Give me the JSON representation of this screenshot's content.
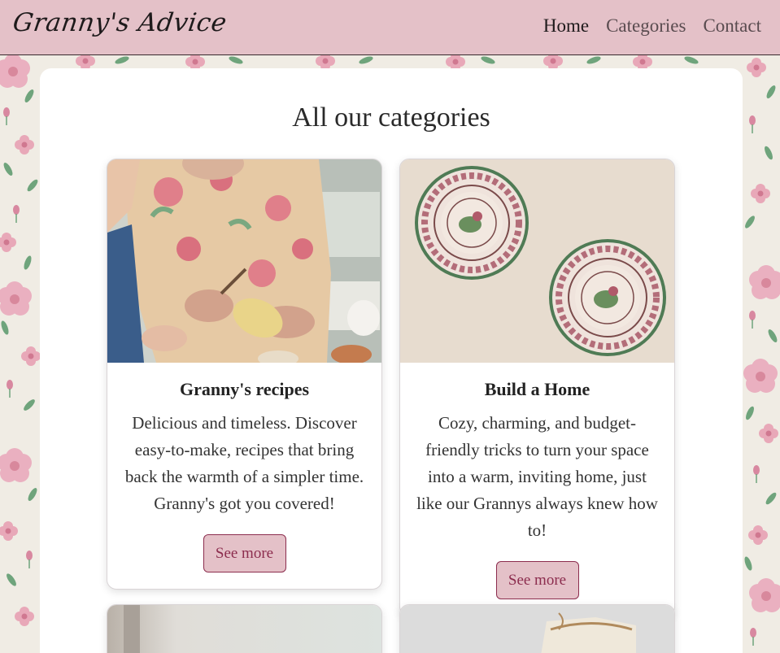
{
  "header": {
    "logo": "Granny's Advice",
    "nav": [
      {
        "label": "Home",
        "active": true
      },
      {
        "label": "Categories",
        "active": false
      },
      {
        "label": "Contact",
        "active": false
      }
    ]
  },
  "main": {
    "title": "All our categories",
    "cards": [
      {
        "title": "Granny's recipes",
        "description": "Delicious and timeless. Discover easy-to-make, recipes that bring back the warmth of a simpler time. Granny's got you covered!",
        "button": "See more"
      },
      {
        "title": "Build a Home",
        "description": "Cozy, charming, and budget-friendly tricks to turn your space into a warm, inviting home, just like our Grannys always knew how to!",
        "button": "See more"
      }
    ]
  },
  "colors": {
    "header_bg": "#e4c1c8",
    "accent": "#8c2d4e",
    "panel_bg": "#ffffff",
    "wallpaper_bg": "#f0ece4"
  }
}
